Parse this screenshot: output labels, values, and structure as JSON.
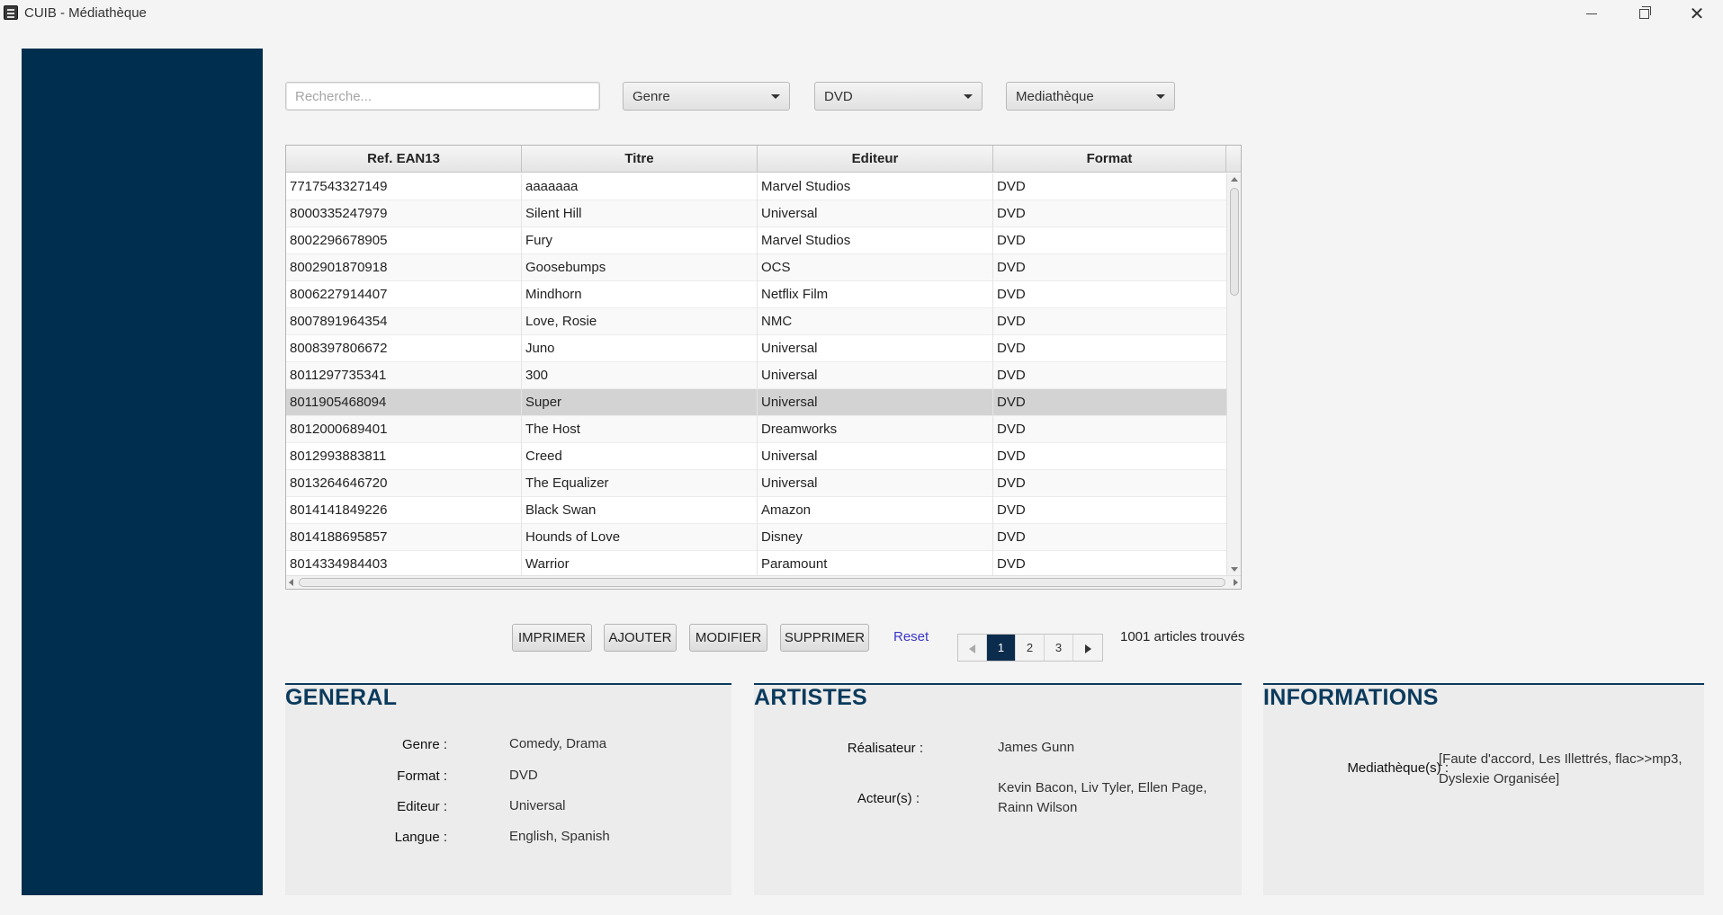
{
  "window": {
    "title": "CUIB - Médiathèque",
    "controls": [
      "minimize",
      "maximize",
      "close"
    ]
  },
  "filters": {
    "search_placeholder": "Recherche...",
    "genre": "Genre",
    "format": "DVD",
    "mediatheque": "Mediathèque"
  },
  "table": {
    "columns": [
      "Ref. EAN13",
      "Titre",
      "Editeur",
      "Format"
    ],
    "rows": [
      [
        "7717543327149",
        "aaaaaaa",
        "Marvel Studios",
        "DVD"
      ],
      [
        "8000335247979",
        "Silent Hill",
        "Universal",
        "DVD"
      ],
      [
        "8002296678905",
        "Fury",
        "Marvel Studios",
        "DVD"
      ],
      [
        "8002901870918",
        "Goosebumps",
        "OCS",
        "DVD"
      ],
      [
        "8006227914407",
        "Mindhorn",
        "Netflix Film",
        "DVD"
      ],
      [
        "8007891964354",
        "Love, Rosie",
        "NMC",
        "DVD"
      ],
      [
        "8008397806672",
        "Juno",
        "Universal",
        "DVD"
      ],
      [
        "8011297735341",
        "300",
        "Universal",
        "DVD"
      ],
      [
        "8011905468094",
        "Super",
        "Universal",
        "DVD"
      ],
      [
        "8012000689401",
        "The Host",
        "Dreamworks",
        "DVD"
      ],
      [
        "8012993883811",
        "Creed",
        "Universal",
        "DVD"
      ],
      [
        "8013264646720",
        "The Equalizer",
        "Universal",
        "DVD"
      ],
      [
        "8014141849226",
        "Black Swan",
        "Amazon",
        "DVD"
      ],
      [
        "8014188695857",
        "Hounds of Love",
        "Disney",
        "DVD"
      ],
      [
        "8014334984403",
        "Warrior",
        "Paramount",
        "DVD"
      ]
    ],
    "selected_row": 8
  },
  "actions": {
    "print": "IMPRIMER",
    "add": "AJOUTER",
    "edit": "MODIFIER",
    "delete": "SUPPRIMER",
    "reset": "Reset"
  },
  "pagination": {
    "pages": [
      "1",
      "2",
      "3"
    ],
    "current": "1",
    "found": "1001 articles trouvés"
  },
  "general": {
    "title": "GENERAL",
    "genre_label": "Genre :",
    "genre_value": "Comedy, Drama",
    "format_label": "Format :",
    "format_value": "DVD",
    "editeur_label": "Editeur :",
    "editeur_value": "Universal",
    "langue_label": "Langue :",
    "langue_value": "English, Spanish"
  },
  "artistes": {
    "title": "ARTISTES",
    "realisateur_label": "Réalisateur :",
    "realisateur_value": "James Gunn",
    "acteurs_label": "Acteur(s) :",
    "acteurs_line1": "Kevin Bacon, Liv Tyler, Ellen Page,",
    "acteurs_line2": "Rainn Wilson"
  },
  "informations": {
    "title": "INFORMATIONS",
    "mediatheques_label": "Mediathèque(s) :",
    "mediatheques_line1": "[Faute d'accord, Les Illettrés, flac>>mp3,",
    "mediatheques_line2": "Dyslexie Organisée]"
  },
  "colors": {
    "sidebar": "#002e4f",
    "accent": "#0b3a5c",
    "reset_link": "#3b35c9"
  }
}
